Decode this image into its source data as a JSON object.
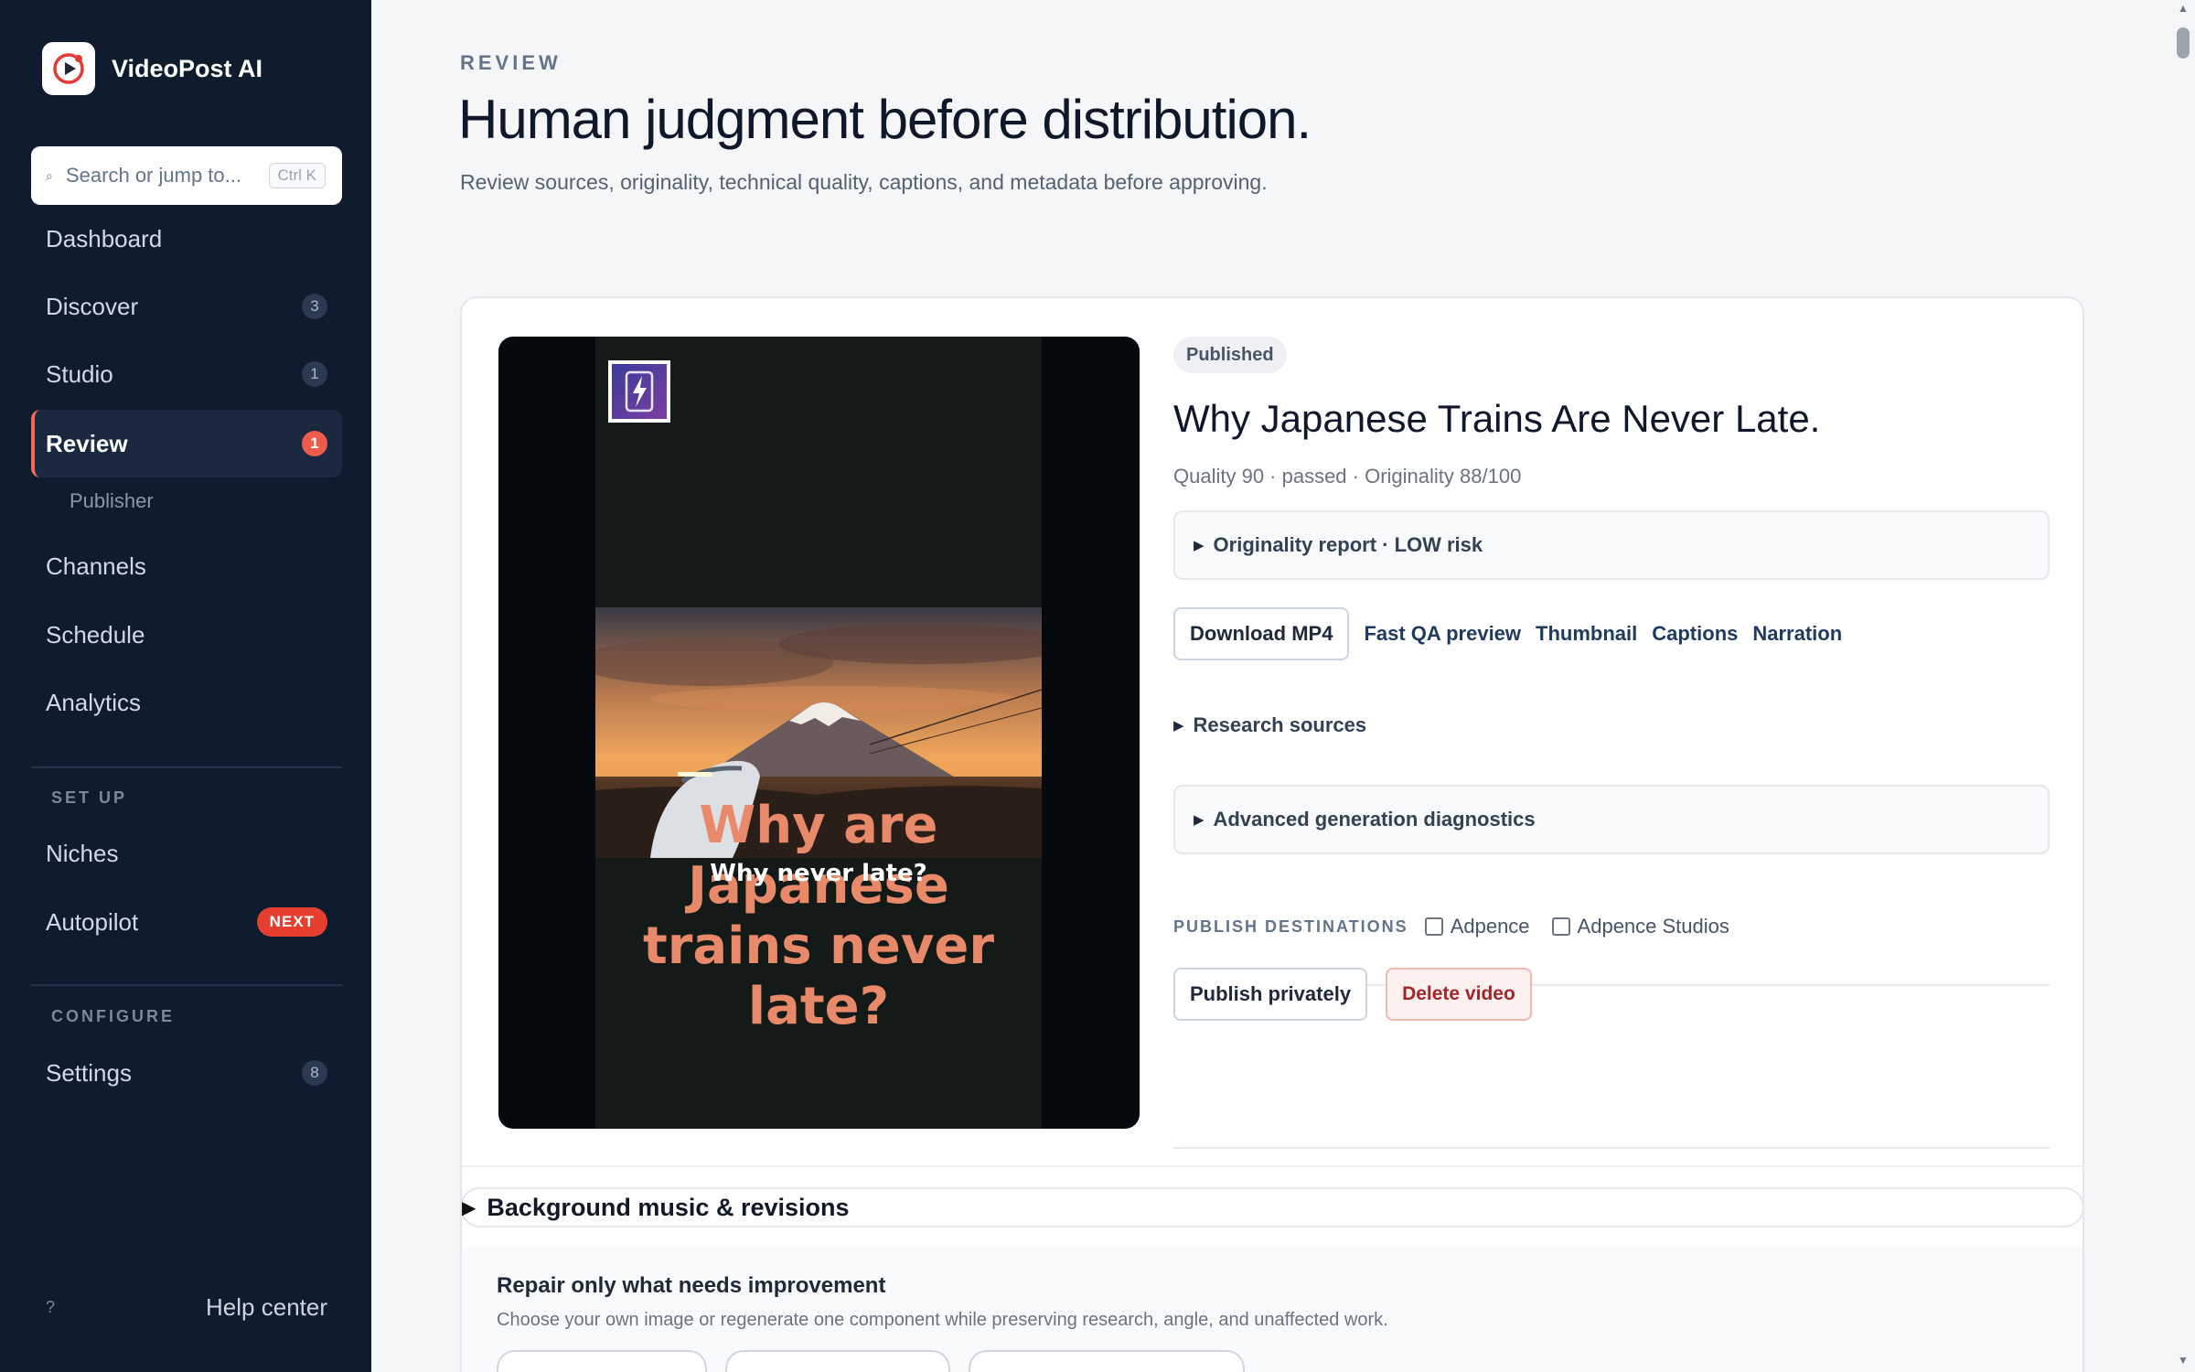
{
  "app": {
    "name": "VideoPost AI"
  },
  "search": {
    "placeholder": "Search or jump to...",
    "shortcut": "Ctrl K"
  },
  "nav": {
    "dashboard": {
      "label": "Dashboard"
    },
    "discover": {
      "label": "Discover",
      "badge": "3"
    },
    "studio": {
      "label": "Studio",
      "badge": "1"
    },
    "review": {
      "label": "Review",
      "badge": "1"
    },
    "publisher": {
      "label": "Publisher"
    },
    "channels": {
      "label": "Channels"
    },
    "schedule": {
      "label": "Schedule"
    },
    "analytics": {
      "label": "Analytics"
    },
    "setup_label": "SET UP",
    "niches": {
      "label": "Niches"
    },
    "autopilot": {
      "label": "Autopilot",
      "badge": "NEXT"
    },
    "configure_label": "CONFIGURE",
    "settings": {
      "label": "Settings",
      "badge": "8"
    },
    "help": {
      "icon_text": "?",
      "label": "Help center"
    }
  },
  "header": {
    "eyebrow": "REVIEW",
    "title": "Human judgment before distribution.",
    "subtitle": "Review sources, originality, technical quality, captions, and metadata before approving."
  },
  "video": {
    "status": "Published",
    "title": "Why Japanese Trains Are Never Late.",
    "meta": "Quality 90 · passed · Originality 88/100",
    "preview_caption_big": "Why are Japanese trains never late?",
    "preview_caption_small": "Why never late?",
    "originality_summary": "Originality report · LOW risk",
    "actions": {
      "download": "Download MP4",
      "fast_qa": "Fast QA preview",
      "thumbnail": "Thumbnail",
      "captions": "Captions",
      "narration": "Narration"
    },
    "research_sources": "Research sources",
    "diagnostics": "Advanced generation diagnostics",
    "destinations": {
      "label": "PUBLISH DESTINATIONS",
      "options": [
        "Adpence",
        "Adpence Studios"
      ]
    },
    "publish_privately": "Publish privately",
    "delete": "Delete video"
  },
  "music": {
    "label": "Background music & revisions"
  },
  "repair": {
    "title": "Repair only what needs improvement",
    "subtitle": "Choose your own image or regenerate one component while preserving research, angle, and unaffected work."
  },
  "colors": {
    "sidebar_bg": "#0f1c2e",
    "accent": "#ef5b4b",
    "caption": "#e8896a"
  }
}
